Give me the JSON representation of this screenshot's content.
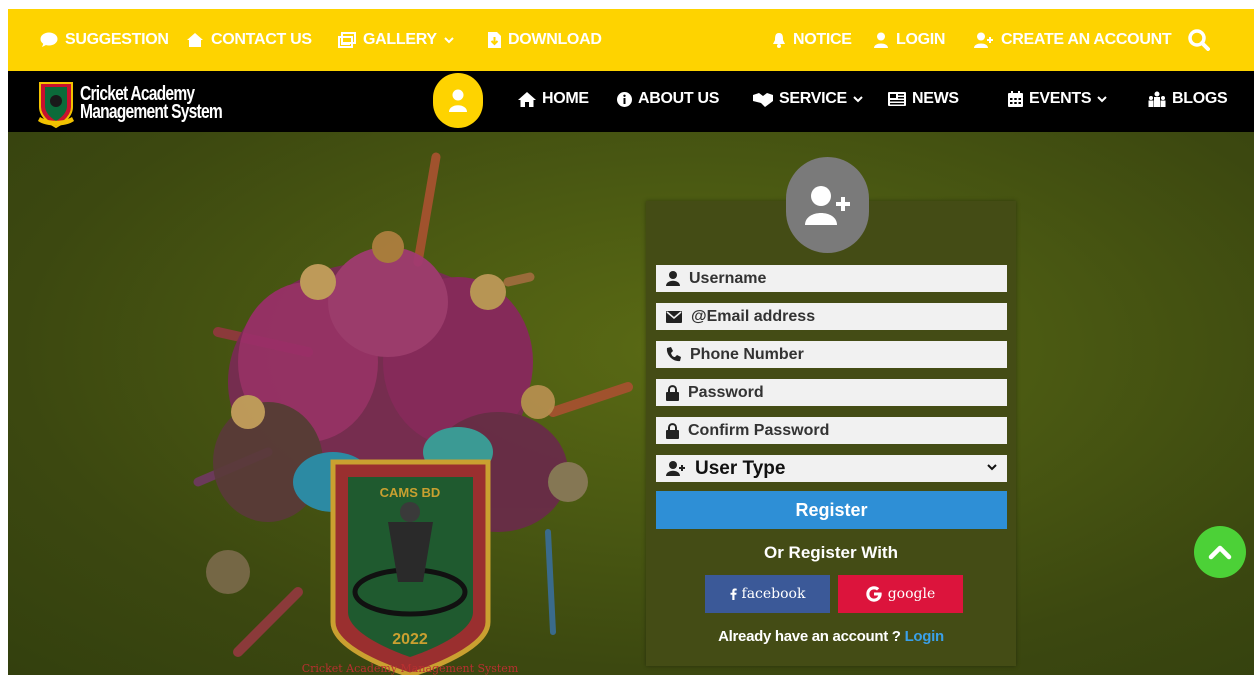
{
  "topbar": {
    "suggestion": "SUGGESTION",
    "contact": "CONTACT US",
    "gallery": "GALLERY",
    "download": "DOWNLOAD",
    "notice": "NOTICE",
    "login": "LOGIN",
    "create_account": "CREATE AN ACCOUNT"
  },
  "logo": {
    "line1": "Cricket Academy",
    "line2": "Management System"
  },
  "nav": {
    "home": "HOME",
    "about": "ABOUT US",
    "service": "SERVICE",
    "news": "NEWS",
    "events": "EVENTS",
    "blogs": "BLOGS"
  },
  "hero": {
    "badge_text": "CAMS BD",
    "badge_year": "2022",
    "badge_ring_text": "Cricket Academy Management System"
  },
  "form": {
    "username_placeholder": "Username",
    "email_placeholder": "@Email address",
    "phone_placeholder": "Phone Number",
    "password_placeholder": "Password",
    "confirm_password_placeholder": "Confirm Password",
    "user_type_selected": "User Type",
    "register_label": "Register",
    "or_register_with": "Or Register With",
    "facebook_label": "facebook",
    "google_label": "google",
    "already_text": "Already have an account ?",
    "login_link": "Login"
  },
  "colors": {
    "top_bar": "#fed300",
    "nav_bar": "#000000",
    "register_button": "#2e8fd6",
    "facebook": "#3b5998",
    "google": "#dc143c",
    "scroll_top": "#4cd137"
  },
  "icons": {
    "suggestion": "comment-icon",
    "contact": "home-icon",
    "gallery": "images-icon",
    "download": "file-download-icon",
    "notice": "bell-icon",
    "login": "user-icon",
    "create_account": "user-plus-icon",
    "search": "search-icon",
    "scroll_top": "chevron-up-icon"
  }
}
